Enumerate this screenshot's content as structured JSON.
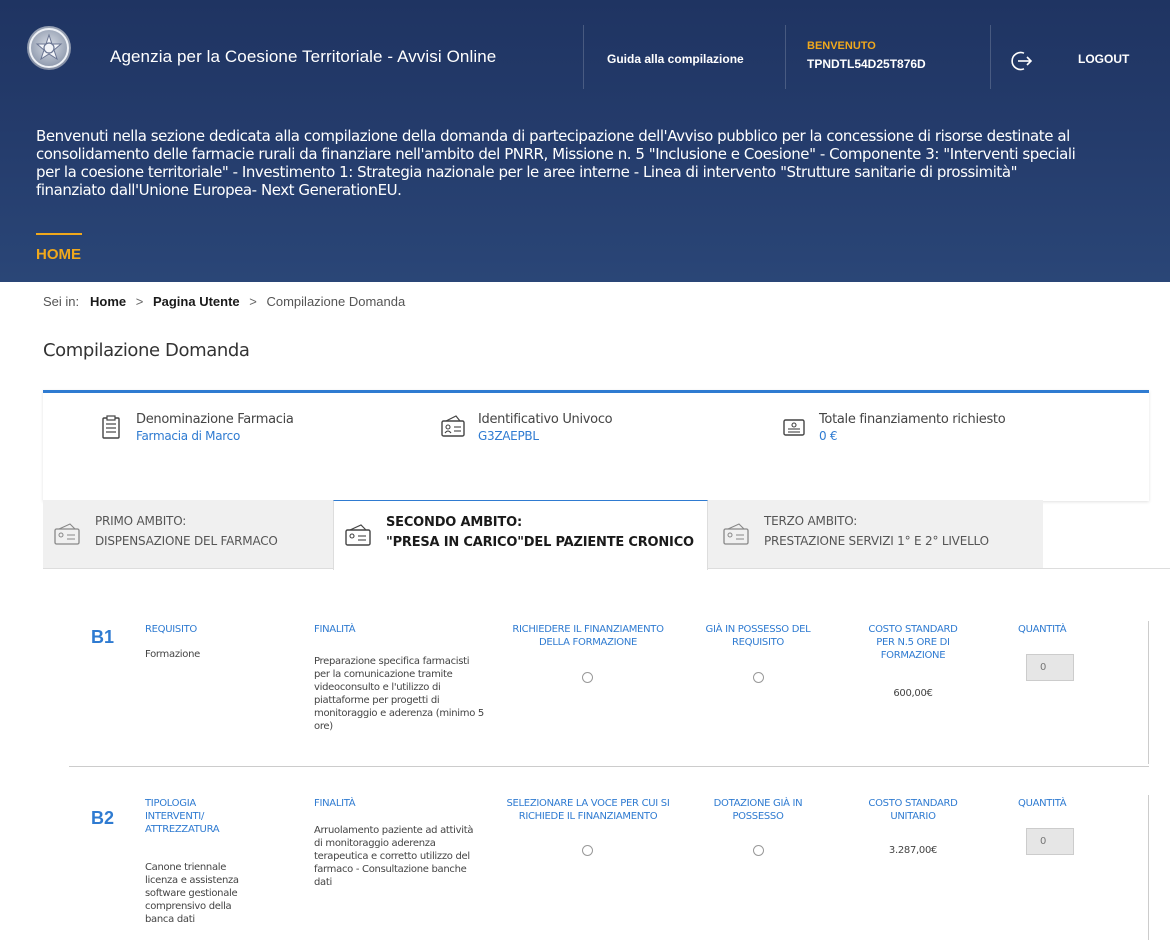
{
  "header": {
    "app_title": "Agenzia per la Coesione Territoriale - Avvisi Online",
    "guide_link": "Guida alla compilazione",
    "welcome_label": "BENVENUTO",
    "username": "TPNDTL54D25T876D",
    "logout_label": "LOGOUT",
    "emblem_icon": "italian-republic-emblem",
    "logout_icon": "logout-icon"
  },
  "intro": {
    "lines": [
      "Benvenuti nella sezione dedicata alla compilazione della domanda di partecipazione dell'Avviso pubblico per la concessione di risorse destinate al",
      "consolidamento delle farmacie rurali da finanziare nell'ambito del PNRR, Missione n. 5 \"Inclusione e Coesione\" - Componente 3: \"Interventi speciali",
      "per la coesione territoriale\" - Investimento 1: Strategia nazionale per le aree interne - Linea di intervento \"Strutture sanitarie di prossimità\"",
      "finanziato dall'Unione Europea- Next GenerationEU."
    ]
  },
  "nav": {
    "home": "HOME"
  },
  "breadcrumb": {
    "prefix": "Sei in:",
    "home": "Home",
    "separator": ">",
    "user_page": "Pagina Utente",
    "current": "Compilazione Domanda"
  },
  "page_title": "Compilazione Domanda",
  "info": {
    "pharmacy_label": "Denominazione Farmacia",
    "pharmacy_value": "Farmacia di Marco",
    "id_label": "Identificativo Univoco",
    "id_value": "G3ZAEPBL",
    "total_label": "Totale finanziamento richiesto",
    "total_value": "0 €"
  },
  "tabs": [
    {
      "line1": "PRIMO AMBITO:",
      "line2": "DISPENSAZIONE DEL FARMACO",
      "active": false
    },
    {
      "line1": "SECONDO AMBITO:",
      "line2": "\"PRESA IN CARICO\"DEL PAZIENTE CRONICO",
      "active": true
    },
    {
      "line1": "TERZO AMBITO:",
      "line2": "PRESTAZIONE SERVIZI 1° E 2° LIVELLO",
      "active": false
    }
  ],
  "rows": [
    {
      "code": "B1",
      "col1_head": "REQUISITO",
      "col1_lines": [
        "Formazione"
      ],
      "col2_head": "FINALITÀ",
      "col2_lines": [
        "Preparazione specifica farmacisti",
        "per la comunicazione tramite",
        "videoconsulto e l'utilizzo di",
        "piattaforme per progetti di",
        "monitoraggio e aderenza (minimo 5",
        "ore)"
      ],
      "col3_head": [
        "RICHIEDERE IL FINANZIAMENTO",
        "DELLA FORMAZIONE"
      ],
      "col4_head": [
        "GIÀ IN POSSESSO DEL",
        "REQUISITO"
      ],
      "col5_head": [
        "COSTO STANDARD",
        "PER N.5 ORE DI",
        "FORMAZIONE"
      ],
      "cost": "600,00€",
      "qty_head": "QUANTITÀ",
      "qty_value": "0"
    },
    {
      "code": "B2",
      "col1_head": [
        "TIPOLOGIA",
        "INTERVENTI/",
        "ATTREZZATURA"
      ],
      "col1_lines": [
        "Canone triennale",
        "licenza e assistenza",
        "software gestionale",
        "comprensivo della",
        "banca dati"
      ],
      "col2_head": "FINALITÀ",
      "col2_lines": [
        "Arruolamento paziente ad attività",
        "di monitoraggio aderenza",
        "terapeutica e corretto utilizzo del",
        "farmaco - Consultazione banche",
        "dati"
      ],
      "col3_head": [
        "SELEZIONARE LA VOCE PER CUI SI",
        "RICHIEDE IL FINANZIAMENTO"
      ],
      "col4_head": [
        "DOTAZIONE GIÀ IN",
        "POSSESSO"
      ],
      "col5_head": [
        "COSTO STANDARD",
        "UNITARIO"
      ],
      "cost": "3.287,00€",
      "qty_head": "QUANTITÀ",
      "qty_value": "0"
    }
  ],
  "colors": {
    "header_bg": "#1f3462",
    "accent": "#f0a81c",
    "link_blue": "#2f7bd1"
  }
}
